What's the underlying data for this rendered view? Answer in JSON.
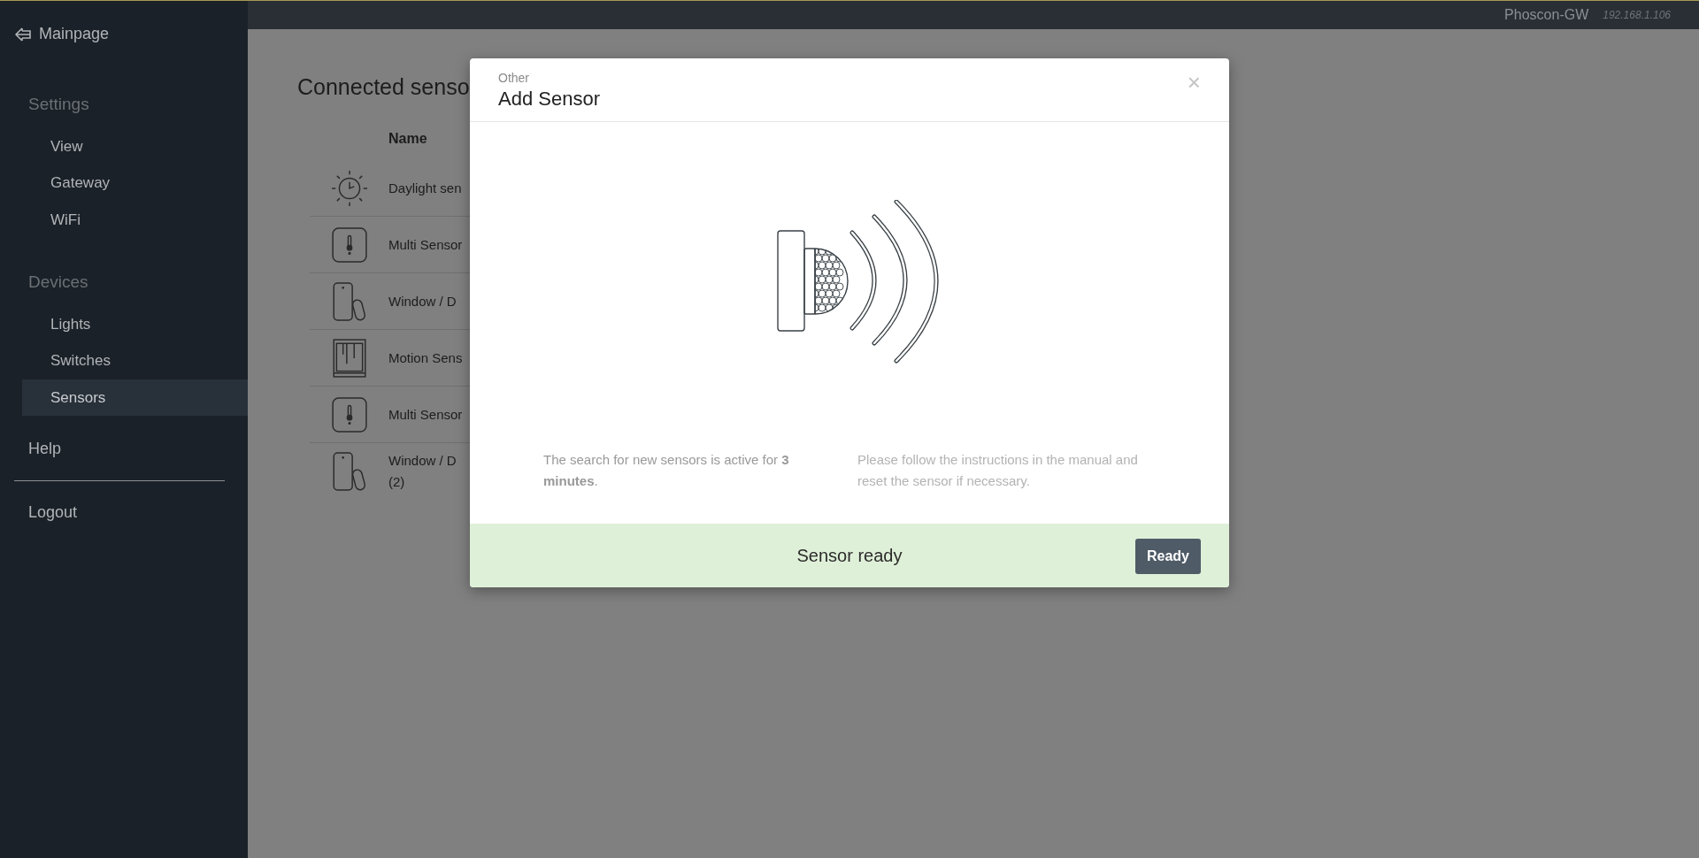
{
  "topbar": {
    "gateway": "Phoscon-GW",
    "ip": "192.168.1.106"
  },
  "sidebar": {
    "back_link": "Mainpage",
    "sections": [
      {
        "heading": "Settings",
        "items": [
          {
            "label": "View",
            "selected": false
          },
          {
            "label": "Gateway",
            "selected": false
          },
          {
            "label": "WiFi",
            "selected": false
          }
        ]
      },
      {
        "heading": "Devices",
        "items": [
          {
            "label": "Lights",
            "selected": false
          },
          {
            "label": "Switches",
            "selected": false
          },
          {
            "label": "Sensors",
            "selected": true
          }
        ]
      }
    ],
    "help": "Help",
    "logout": "Logout"
  },
  "page": {
    "title": "Connected senso",
    "table": {
      "columns": [
        "Name"
      ],
      "rows": [
        {
          "kind": "daylight",
          "name": "Daylight sen"
        },
        {
          "kind": "multi",
          "name": "Multi Sensor"
        },
        {
          "kind": "door",
          "name": "Window / D"
        },
        {
          "kind": "motion",
          "name": "Motion Sens"
        },
        {
          "kind": "multi",
          "name": "Multi Sensor"
        },
        {
          "kind": "door",
          "name": "Window / D",
          "name_line_2": "(2)"
        }
      ]
    }
  },
  "modal": {
    "category": "Other",
    "title": "Add Sensor",
    "close": "×",
    "info": "The search for new sensors is active for **3 minutes**.",
    "hint": "Please follow the instructions in the manual and reset the sensor if necessary.",
    "status": "Sensor ready",
    "button": "Ready"
  }
}
